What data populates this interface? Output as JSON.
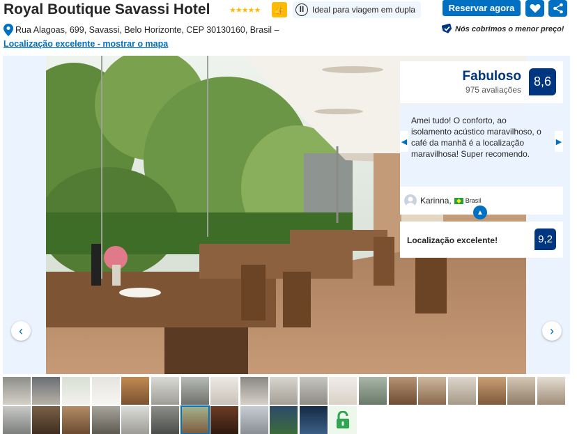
{
  "hotel": {
    "name": "Royal Boutique Savassi Hotel",
    "stars": "★★★★★",
    "ideal_for": "Ideal para viagem em dupla",
    "address": "Rua Alagoas, 699, Savassi, Belo Horizonte, CEP 30130160, Brasil –",
    "location_link": "Localização excelente - mostrar o mapa"
  },
  "actions": {
    "reserve_label": "Reservar agora",
    "price_guarantee": "Nós cobrimos o menor preço!"
  },
  "review": {
    "score_word": "Fabuloso",
    "review_count": "975 avaliações",
    "score": "8,6",
    "quote": "Amei tudo! O conforto, ao isolamento acústico maravilhoso, o café da manhã é a localização maravilhosa! Super recomendo.",
    "reviewer_name": "Karinna,",
    "reviewer_country": "Brasil",
    "location_label": "Localização excelente!",
    "location_score": "9,2"
  },
  "gallery": {
    "prev_icon": "‹",
    "next_icon": "›",
    "thumbnail_count": 29
  },
  "colors": {
    "primary": "#0071c2",
    "dark_blue": "#003580",
    "star_yellow": "#febb02",
    "panel_bg": "#ebf3ff"
  }
}
